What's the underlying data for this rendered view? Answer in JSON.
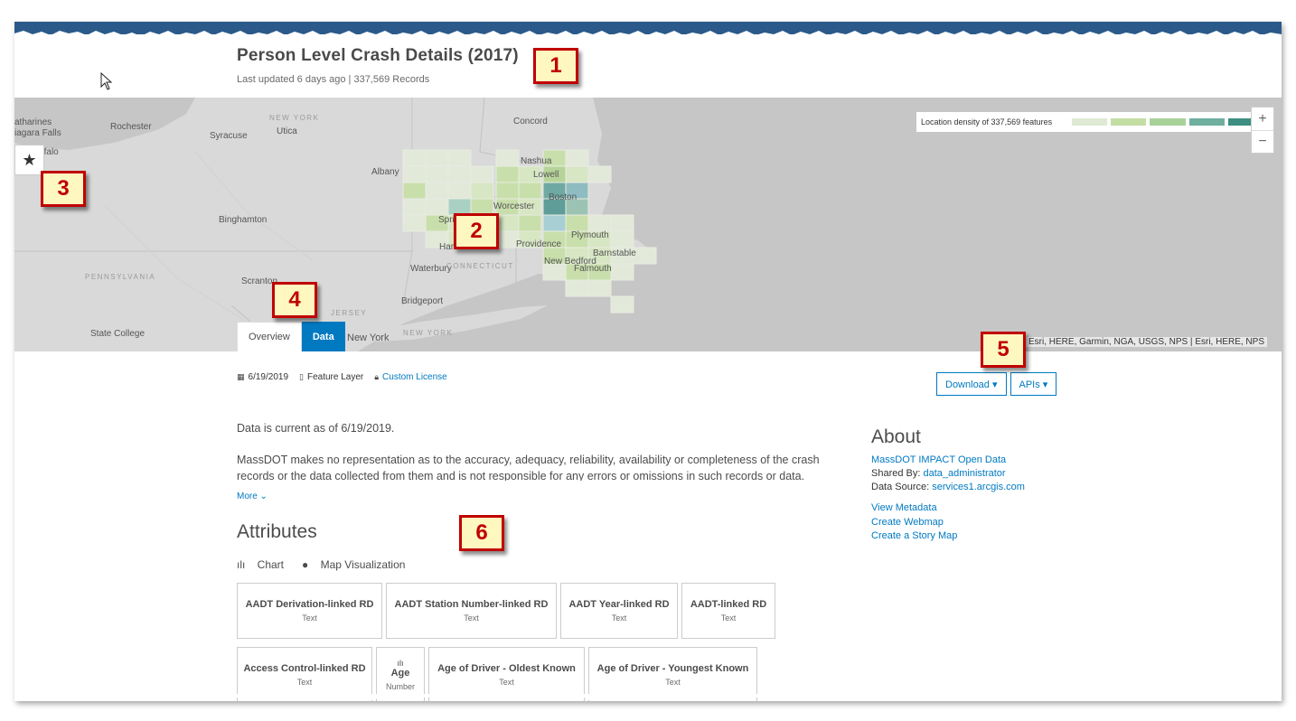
{
  "header": {
    "title": "Person Level Crash Details (2017)",
    "subtitle": "Last updated 6 days ago | 337,569 Records"
  },
  "map": {
    "legend_text": "Location density of 337,569 features",
    "legend_colors": [
      "#dfe9d3",
      "#c3dea3",
      "#a9d19a",
      "#6eaf9e",
      "#3e8f83"
    ],
    "zoom_in": "+",
    "zoom_out": "−",
    "attribution": "Esri, HERE, Garmin, NGA, USGS, NPS | Esri, HERE, NPS",
    "favorite_icon": "★",
    "labels": {
      "catharines": "atharines",
      "niagara": "iagara Falls",
      "buffalo": "ffalo",
      "rochester": "Rochester",
      "syracuse": "Syracuse",
      "utica": "Utica",
      "new_york_state": "NEW YORK",
      "albany": "Albany",
      "binghamton": "Binghamton",
      "pennsylvania": "PENNSYLVANIA",
      "scranton": "Scranton",
      "state_college": "State College",
      "concord": "Concord",
      "nashua": "Nashua",
      "lowell": "Lowell",
      "boston": "Boston",
      "worcester": "Worcester",
      "springfield": "Spri",
      "hartford": "Har",
      "providence": "Providence",
      "plymouth": "Plymouth",
      "barnstable": "Barnstable",
      "new_bedford": "New Bedford",
      "falmouth": "Falmouth",
      "waterbury": "Waterbury",
      "connecticut": "CONNECTICUT",
      "bridgeport": "Bridgeport",
      "jersey": "JERSEY",
      "new_york_city": "New York",
      "new_york_state2": "NEW YORK"
    }
  },
  "tabs": [
    {
      "label": "Overview"
    },
    {
      "label": "Data"
    }
  ],
  "meta": {
    "date": "6/19/2019",
    "type": "Feature Layer",
    "license": "Custom License"
  },
  "buttons": {
    "download": "Download ▾",
    "apis": "APIs ▾"
  },
  "description": {
    "current": "Data is current as of 6/19/2019.",
    "text": "MassDOT makes no representation as to the accuracy, adequacy, reliability, availability or completeness of the crash records or the data collected from them and is not responsible for any errors or omissions in such records or data.",
    "more": "More ⌄"
  },
  "attributes": {
    "title": "Attributes",
    "chart_label": "Chart",
    "map_viz_label": "Map Visualization",
    "cards": [
      {
        "name": "AADT Derivation-linked RD",
        "type": "Text"
      },
      {
        "name": "AADT Station Number-linked RD",
        "type": "Text"
      },
      {
        "name": "AADT Year-linked RD",
        "type": "Text"
      },
      {
        "name": "AADT-linked RD",
        "type": "Text"
      },
      {
        "name": "Access Control-linked RD",
        "type": "Text"
      },
      {
        "name": "Age",
        "type": "Number"
      },
      {
        "name": "Age of Driver - Oldest Known",
        "type": "Text"
      },
      {
        "name": "Age of Driver - Youngest Known",
        "type": "Text"
      }
    ]
  },
  "about": {
    "title": "About",
    "org": "MassDOT IMPACT Open Data",
    "shared_by_label": "Shared By: ",
    "shared_by": "data_administrator",
    "source_label": "Data Source: ",
    "source": "services1.arcgis.com",
    "links": [
      "View Metadata",
      "Create Webmap",
      "Create a Story Map"
    ]
  },
  "callouts": [
    "1",
    "2",
    "3",
    "4",
    "5",
    "6"
  ]
}
